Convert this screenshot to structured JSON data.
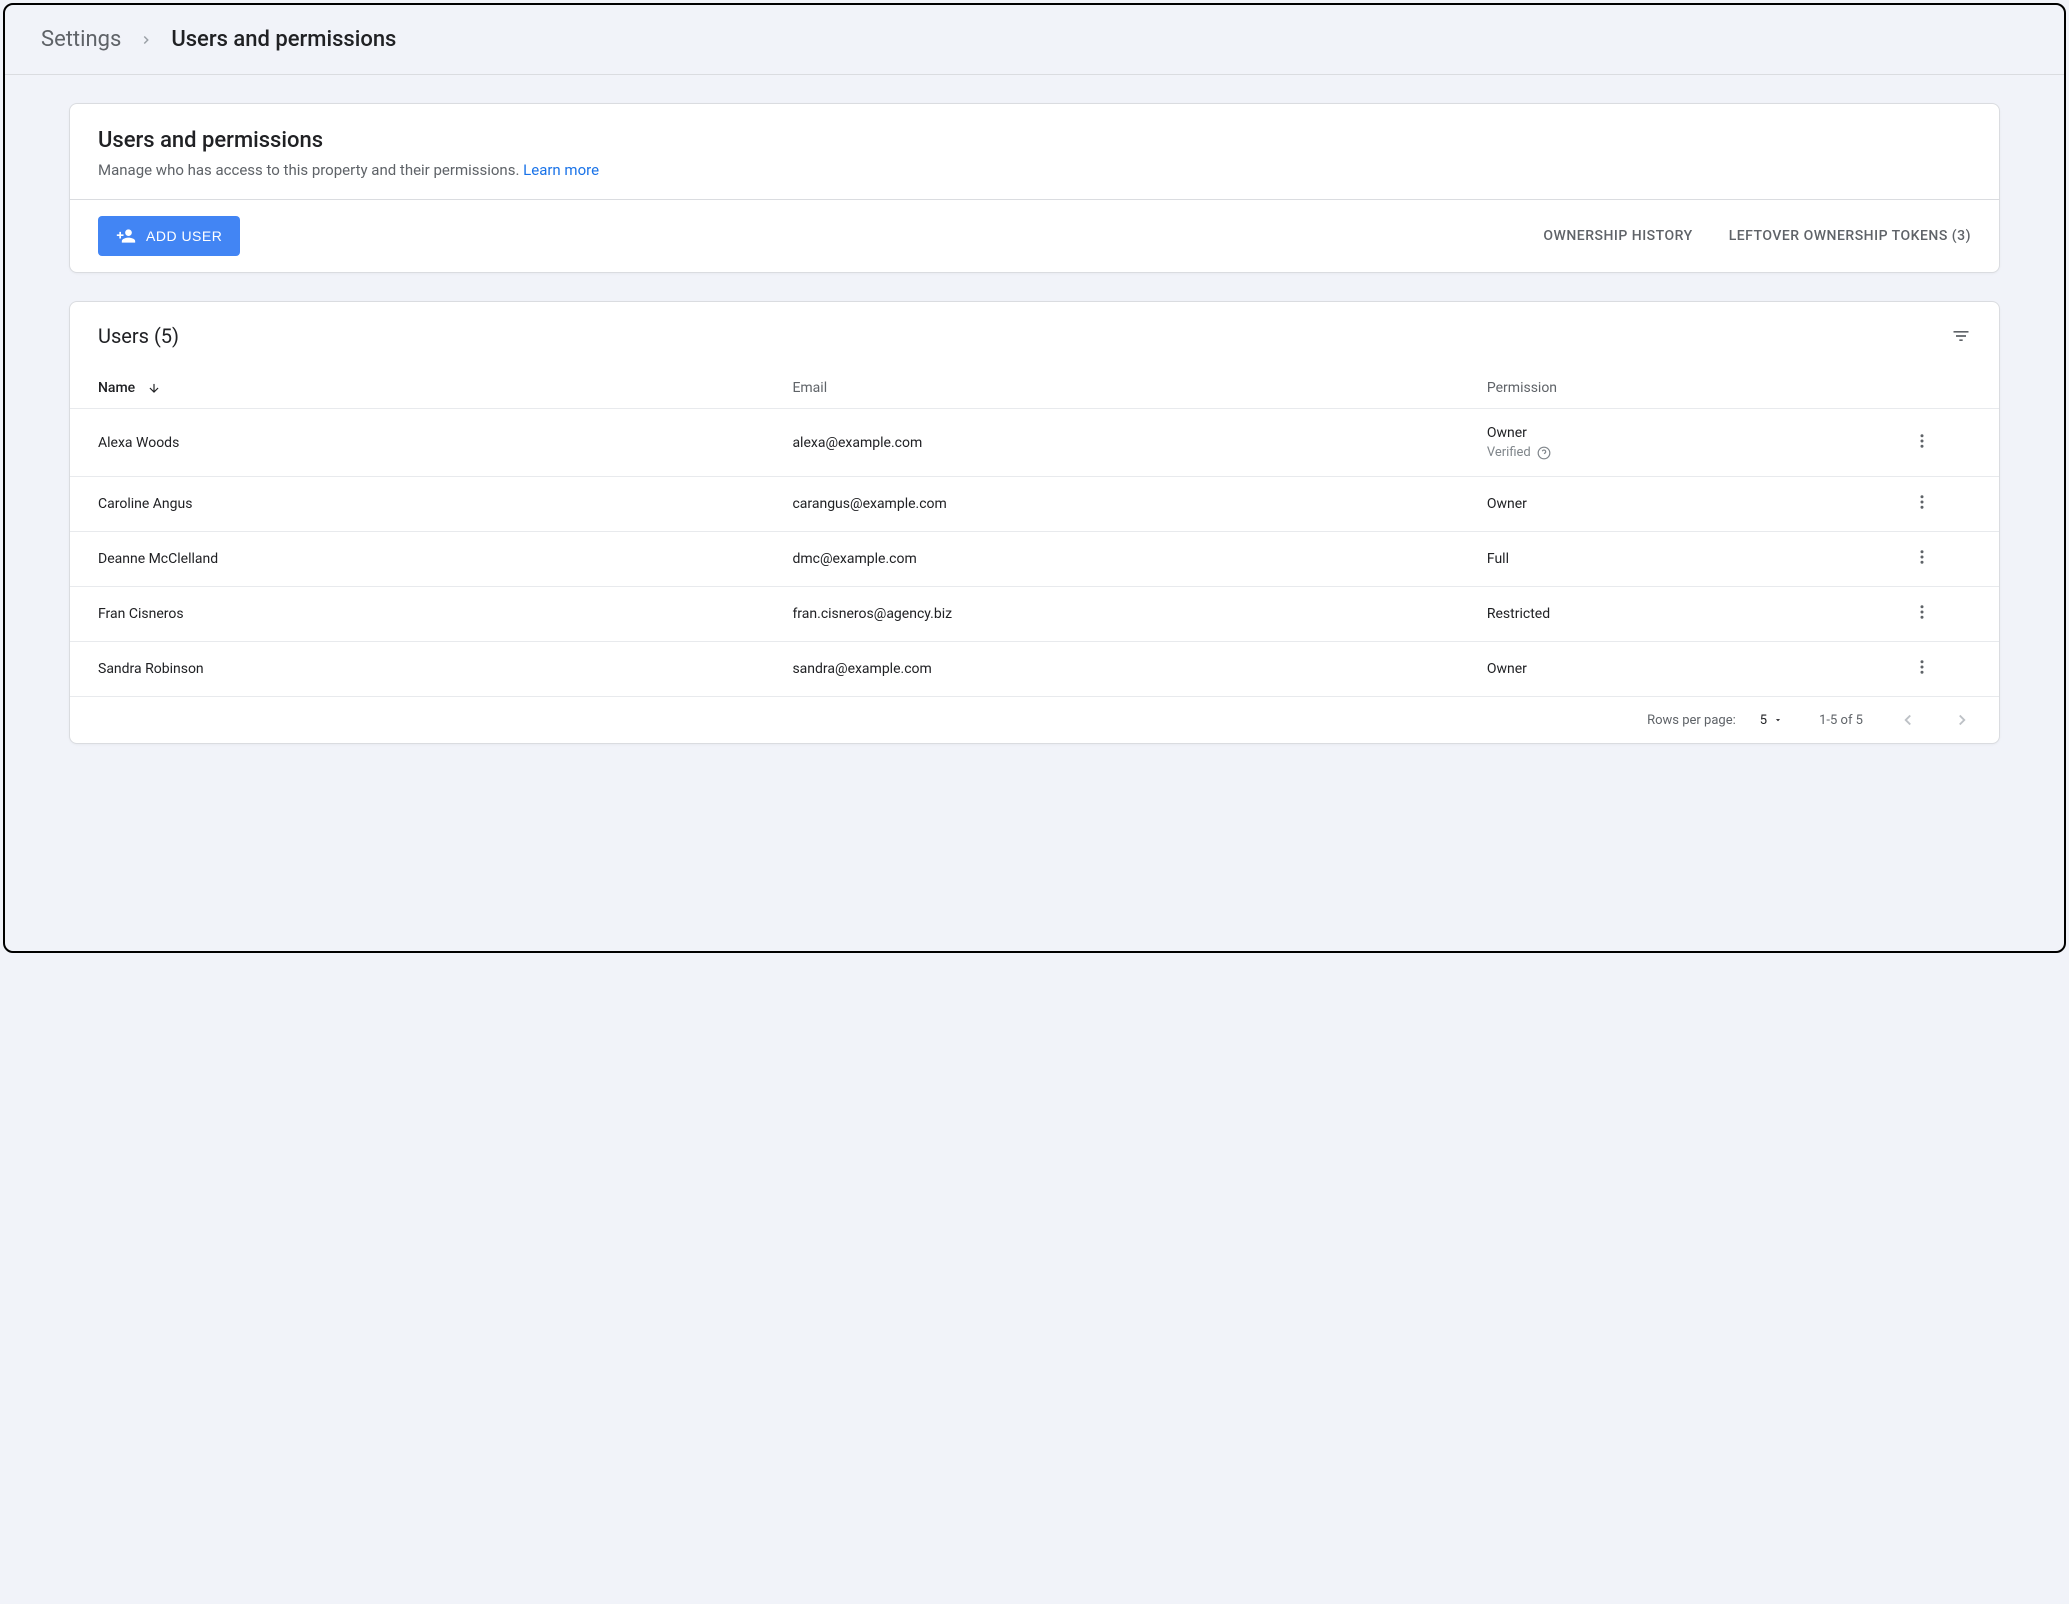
{
  "breadcrumb": {
    "root": "Settings",
    "current": "Users and permissions"
  },
  "header": {
    "title": "Users and permissions",
    "description": "Manage who has access to this property and their permissions.",
    "learn_more": "Learn more"
  },
  "toolbar": {
    "add_user_label": "ADD USER",
    "ownership_history_label": "OWNERSHIP HISTORY",
    "leftover_tokens_label": "LEFTOVER OWNERSHIP TOKENS (3)"
  },
  "table": {
    "title": "Users (5)",
    "columns": {
      "name": "Name",
      "email": "Email",
      "permission": "Permission"
    },
    "rows": [
      {
        "name": "Alexa Woods",
        "email": "alexa@example.com",
        "permission": "Owner",
        "verified_label": "Verified"
      },
      {
        "name": "Caroline Angus",
        "email": "carangus@example.com",
        "permission": "Owner"
      },
      {
        "name": "Deanne McClelland",
        "email": "dmc@example.com",
        "permission": "Full"
      },
      {
        "name": "Fran Cisneros",
        "email": "fran.cisneros@agency.biz",
        "permission": "Restricted"
      },
      {
        "name": "Sandra Robinson",
        "email": "sandra@example.com",
        "permission": "Owner"
      }
    ]
  },
  "pagination": {
    "rows_per_page_label": "Rows per page:",
    "rows_per_page_value": "5",
    "range_label": "1-5 of 5"
  }
}
